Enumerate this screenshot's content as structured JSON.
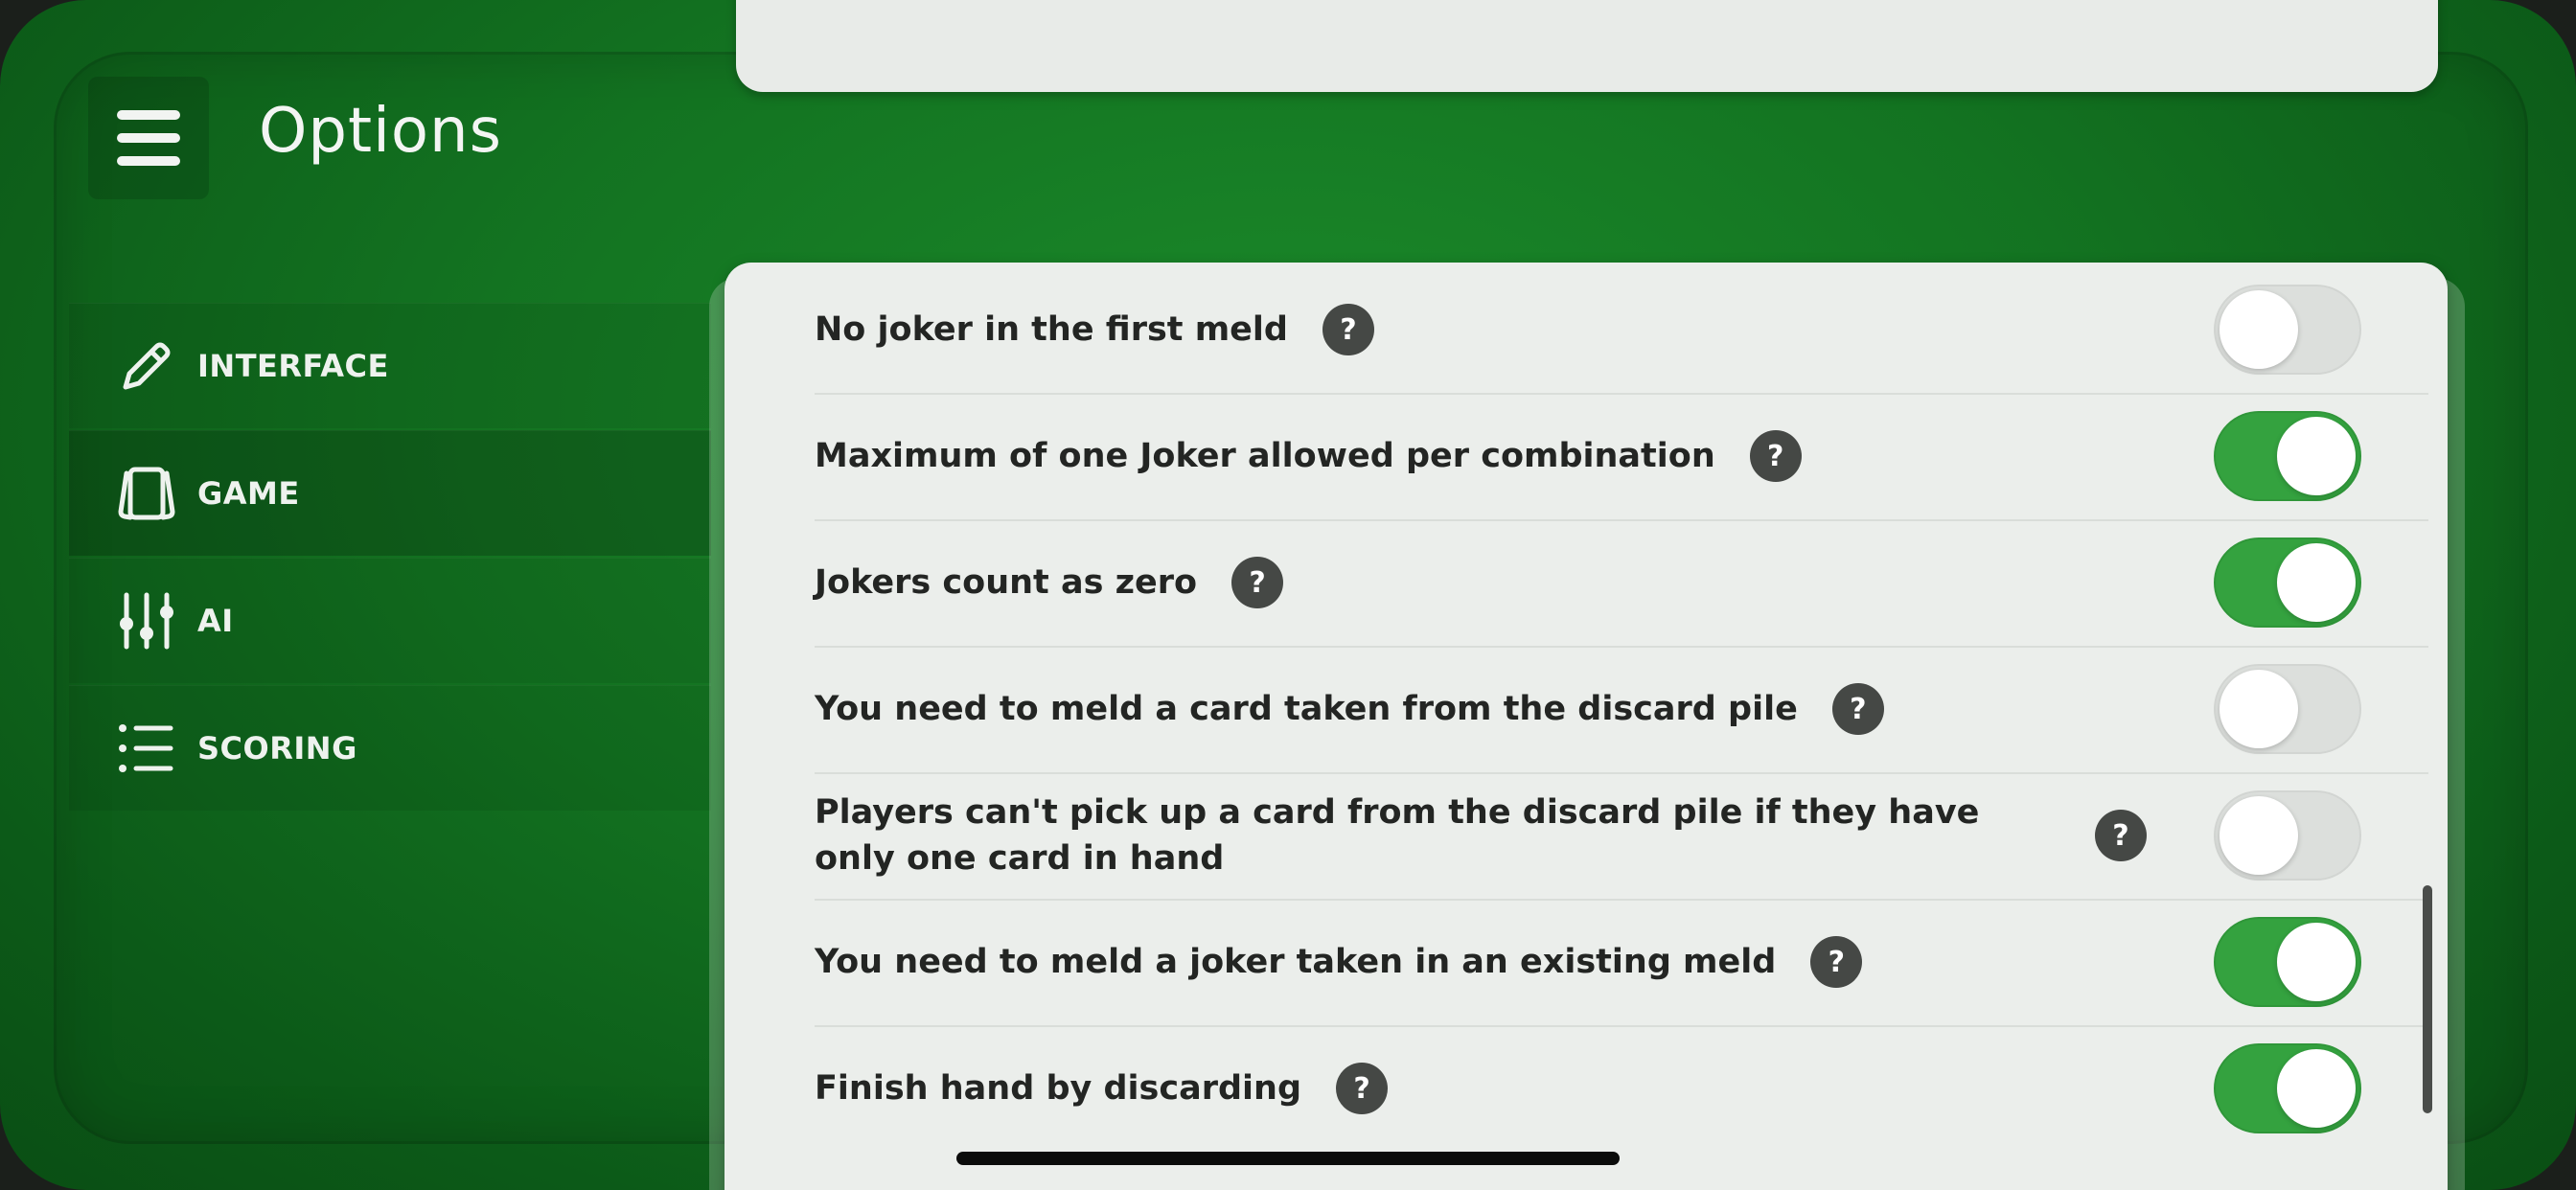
{
  "header": {
    "title": "Options",
    "menu_icon": "hamburger-icon"
  },
  "sidebar": {
    "items": [
      {
        "label": "INTERFACE",
        "icon": "pencil-icon",
        "active": false
      },
      {
        "label": "GAME",
        "icon": "cards-icon",
        "active": true
      },
      {
        "label": "AI",
        "icon": "sliders-icon",
        "active": false
      },
      {
        "label": "SCORING",
        "icon": "list-icon",
        "active": false
      }
    ]
  },
  "options": [
    {
      "label": "No joker in the first meld",
      "help": "?",
      "enabled": false
    },
    {
      "label": "Maximum of one Joker allowed per combination",
      "help": "?",
      "enabled": true
    },
    {
      "label": "Jokers count as zero",
      "help": "?",
      "enabled": true
    },
    {
      "label": "You need to meld a card taken from the discard pile",
      "help": "?",
      "enabled": false
    },
    {
      "label": "Players can't pick up a card from the discard pile if they have only one card in hand",
      "help": "?",
      "enabled": false
    },
    {
      "label": "You need to meld a joker taken in an existing meld",
      "help": "?",
      "enabled": true
    },
    {
      "label": "Finish hand by discarding",
      "help": "?",
      "enabled": true
    }
  ],
  "colors": {
    "felt_green": "#137321",
    "toggle_on": "#34a23f",
    "toggle_off": "#dcdfdc",
    "card_bg": "#ebeeeb"
  }
}
